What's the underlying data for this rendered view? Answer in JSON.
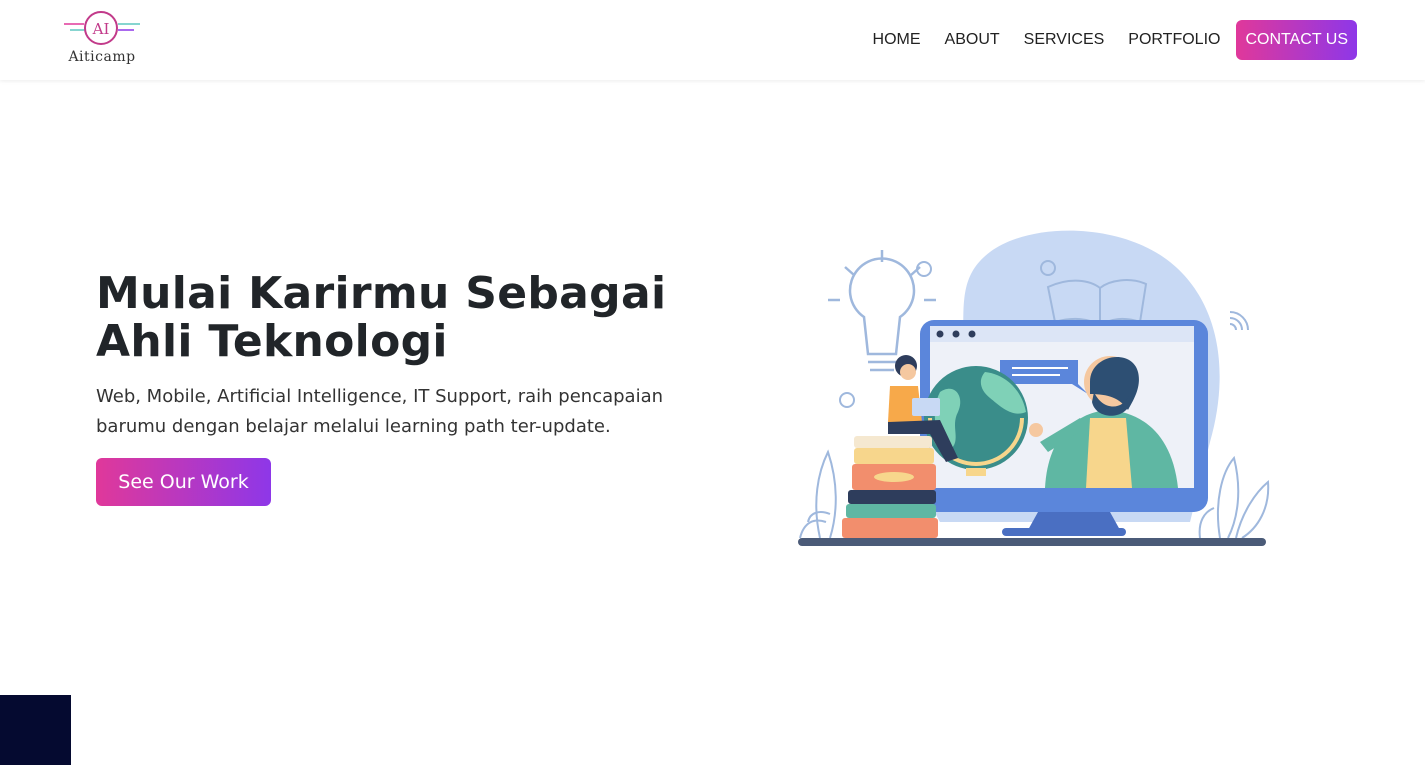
{
  "brand": {
    "logo_mark": "AI",
    "name": "Aiticamp",
    "colors": {
      "pink": "#e0389a",
      "purple": "#8e37e8",
      "teal": "#5fc7c1"
    }
  },
  "nav": {
    "items": [
      {
        "label": "HOME"
      },
      {
        "label": "ABOUT"
      },
      {
        "label": "SERVICES"
      },
      {
        "label": "PORTFOLIO"
      }
    ],
    "cta_label": "CONTACT US"
  },
  "hero": {
    "title_line1": "Mulai Karirmu Sebagai",
    "title_line2": "Ahli Teknologi",
    "subtitle": "Web, Mobile, Artificial Intelligence, IT Support, raih pencapaian barumu dengan belajar melalui learning path ter-update.",
    "button_label": "See Our Work"
  },
  "illustration": {
    "icon": "online-learning-illustration",
    "colors": {
      "blob": "#c8d9f4",
      "monitor": "#5b86db",
      "screen": "#eef1f8",
      "globe": "#3a8d8a",
      "books": "#f28e6d"
    }
  }
}
